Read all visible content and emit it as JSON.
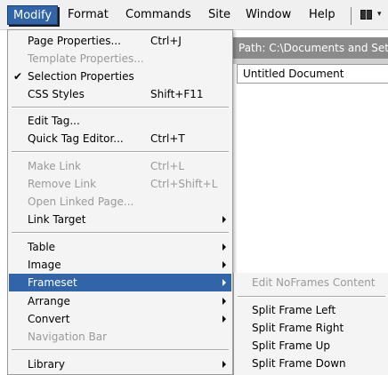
{
  "menubar": {
    "items": [
      "Modify",
      "Format",
      "Commands",
      "Site",
      "Window",
      "Help"
    ],
    "active_index": 0,
    "layout_icon": "layout-grid-icon",
    "dropdown_icon": "chevron-down-icon"
  },
  "document": {
    "path": "Path:  C:\\Documents and Settings",
    "title_value": "Untitled Document"
  },
  "menu": {
    "page_properties": {
      "label": "Page Properties...",
      "shortcut": "Ctrl+J"
    },
    "template_properties": {
      "label": "Template Properties..."
    },
    "selection_properties": {
      "label": "Selection Properties",
      "check": "✔"
    },
    "css_styles": {
      "label": "CSS Styles",
      "shortcut": "Shift+F11"
    },
    "edit_tag": {
      "label": "Edit Tag..."
    },
    "quick_tag_editor": {
      "label": "Quick Tag Editor...",
      "shortcut": "Ctrl+T"
    },
    "make_link": {
      "label": "Make Link",
      "shortcut": "Ctrl+L"
    },
    "remove_link": {
      "label": "Remove Link",
      "shortcut": "Ctrl+Shift+L"
    },
    "open_linked_page": {
      "label": "Open Linked Page..."
    },
    "link_target": {
      "label": "Link Target"
    },
    "table": {
      "label": "Table"
    },
    "image": {
      "label": "Image"
    },
    "frameset": {
      "label": "Frameset"
    },
    "arrange": {
      "label": "Arrange"
    },
    "convert": {
      "label": "Convert"
    },
    "navigation_bar": {
      "label": "Navigation Bar"
    },
    "library": {
      "label": "Library"
    }
  },
  "submenu": {
    "edit_noframes": {
      "label": "Edit NoFrames Content"
    },
    "split_left": {
      "label": "Split Frame Left"
    },
    "split_right": {
      "label": "Split Frame Right"
    },
    "split_up": {
      "label": "Split Frame Up"
    },
    "split_down": {
      "label": "Split Frame Down"
    }
  },
  "colors": {
    "highlight": "#3164a8",
    "menu_background": "#f4f4f4",
    "disabled_text": "#9a9a9a",
    "path_bar": "#8a8a8a"
  }
}
